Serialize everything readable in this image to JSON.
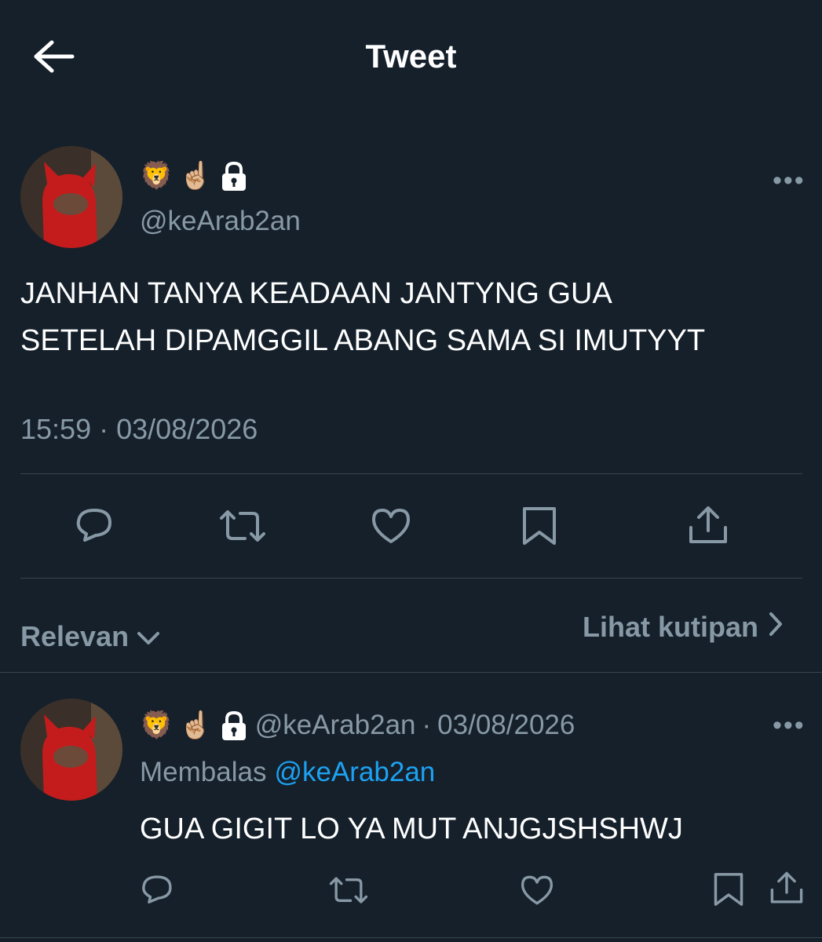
{
  "header": {
    "title": "Tweet"
  },
  "tweet": {
    "emojis": [
      "🦁",
      "☝🏼"
    ],
    "handle": "@keArab2an",
    "text_lines": [
      "JANHAN TANYA KEADAAN JANTYNG GUA",
      "SETELAH DIPAMGGIL ABANG SAMA SI IMUTYYT"
    ],
    "time": "15:59",
    "separator": "·",
    "date": "03/08/2026",
    "more": "•••"
  },
  "filter": {
    "sort_label": "Relevan",
    "quotes_label": "Lihat kutipan"
  },
  "reply": {
    "emojis": [
      "🦁",
      "☝🏼"
    ],
    "handle": "@keArab2an",
    "separator": "·",
    "date": "03/08/2026",
    "replying_prefix": "Membalas",
    "replying_to": "@keArab2an",
    "text": "GUA GIGIT LO YA MUT ANJGJSHSHWJ",
    "more": "•••"
  },
  "icons": {
    "back": "arrow-left-icon",
    "lock": "lock-icon",
    "reply": "reply-icon",
    "retweet": "retweet-icon",
    "like": "heart-icon",
    "bookmark": "bookmark-icon",
    "share": "share-icon"
  },
  "colors": {
    "background": "#15202b",
    "text": "#ffffff",
    "secondary": "#8899a6",
    "link": "#1da1f2",
    "divider": "#38444d"
  }
}
